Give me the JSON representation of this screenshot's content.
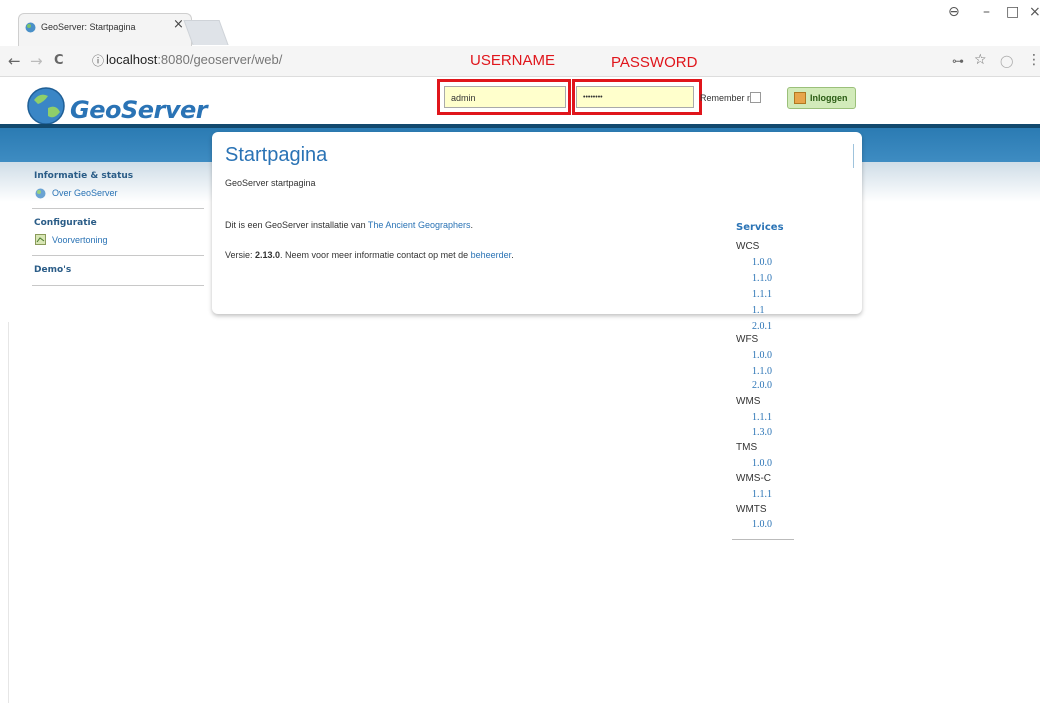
{
  "browser": {
    "tab_title": "GeoServer: Startpagina",
    "tab_close": "×",
    "url_host": "localhost",
    "url_rest": ":8080/geoserver/web/",
    "controls": {
      "profile": "⊖",
      "minimize": "–",
      "maximize": "□",
      "close": "×"
    },
    "nav": {
      "back": "←",
      "forward": "→",
      "reload": "C",
      "info": "ⓘ",
      "key": "⊶",
      "star": "☆",
      "ext": "◯",
      "menu": "⋮"
    }
  },
  "header": {
    "logo_text": "GeoServer",
    "username_value": "admin",
    "password_value": "••••••••",
    "remember_label": "Remember me",
    "login_label": "Inloggen",
    "annot_username": "USERNAME",
    "annot_password": "PASSWORD"
  },
  "sidebar": {
    "sections": [
      {
        "title": "Informatie & status",
        "items": [
          "Over GeoServer"
        ]
      },
      {
        "title": "Configuratie",
        "items": [
          "Voorvertoning"
        ]
      },
      {
        "title": "Demo's",
        "items": []
      }
    ]
  },
  "main": {
    "title": "Startpagina",
    "subtitle": "GeoServer startpagina",
    "install_prefix": "Dit is een GeoServer installatie van ",
    "install_link": "The Ancient Geographers",
    "install_suffix": ".",
    "version_prefix": "Versie: ",
    "version_value": "2.13.0",
    "version_mid": ". Neem voor meer informatie contact op met de ",
    "version_link": "beheerder",
    "version_suffix": "."
  },
  "services": {
    "title": "Services",
    "groups": [
      {
        "name": "WCS",
        "versions": [
          "1.0.0",
          "1.1.0",
          "1.1.1",
          "1.1",
          "2.0.1"
        ]
      },
      {
        "name": "WFS",
        "versions": [
          "1.0.0",
          "1.1.0",
          "2.0.0"
        ]
      },
      {
        "name": "WMS",
        "versions": [
          "1.1.1",
          "1.3.0"
        ]
      },
      {
        "name": "TMS",
        "versions": [
          "1.0.0"
        ]
      },
      {
        "name": "WMS-C",
        "versions": [
          "1.1.1"
        ]
      },
      {
        "name": "WMTS",
        "versions": [
          "1.0.0"
        ]
      }
    ]
  },
  "colors": {
    "brand_blue": "#2a73b5",
    "annotation_red": "#e0151b",
    "field_yellow": "#ffffcc"
  }
}
